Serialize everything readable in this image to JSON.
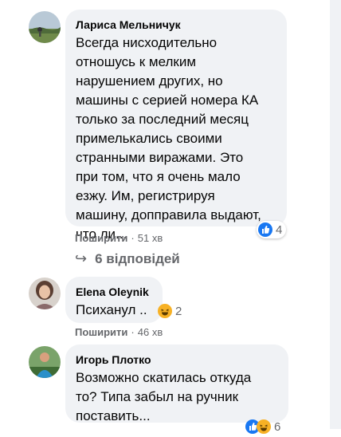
{
  "comments": [
    {
      "author": "Лариса Мельничук",
      "text": "Всегда нисходительно\nотношусь к мелким\nнарушением других, но\nмашины с серией номера КА\nтолько за последний месяц\nпримелькались своими\nстранными виражами. Это\nпри том, что я очень мало\nезжу. Им, регистрируя\nмашину, доппravila выдают,\nчто ли...",
      "share_label": "Поширити",
      "time": "51 хв",
      "reactions": {
        "types": [
          "like-icon"
        ],
        "count": "4"
      }
    },
    {
      "author": "Elena Oleynik",
      "text": "Психанул ..",
      "share_label": "Поширити",
      "time": "46 хв",
      "reactions": {
        "types": [
          "haha-icon"
        ],
        "count": "2"
      }
    },
    {
      "author": "Игорь Плотко",
      "text": "Возможно скатилась откуда\nто? Типа забыл на ручник\nпоставить...",
      "share_label": "",
      "time": "",
      "reactions": {
        "types": [
          "like-icon",
          "haha-icon"
        ],
        "count": "6"
      }
    }
  ],
  "replies": {
    "arrow": "↪",
    "label": "6 відповідей"
  },
  "separator": "·",
  "colors": {
    "bubble": "#f0f2f5",
    "meta_text": "#65676b",
    "like": "#1877f2",
    "haha": "#f7b125"
  }
}
